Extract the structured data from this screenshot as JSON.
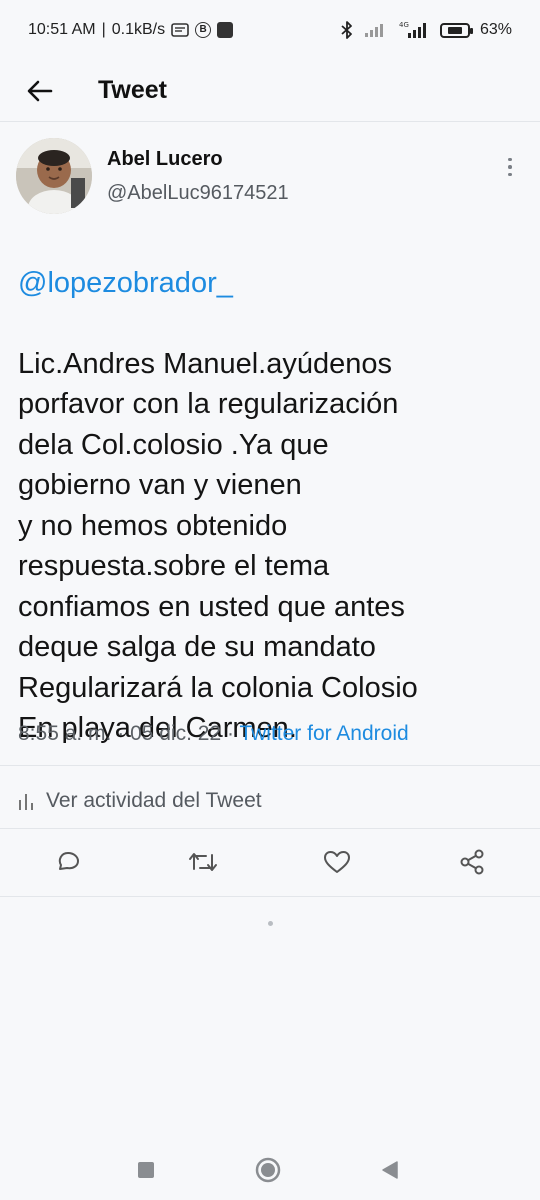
{
  "status_bar": {
    "time": "10:51 AM",
    "speed": "0.1kB/s",
    "network_label": "4G",
    "battery_text": "63%",
    "battery_level": 0.63
  },
  "header": {
    "title": "Tweet"
  },
  "tweet": {
    "author_name": "Abel Lucero",
    "author_handle": "@AbelLuc96174521",
    "mention": "@lopezobrador_",
    "text": "  Lic.Andres Manuel.ayúdenos\nporfavor  con la regularización\ndela Col.colosio .Ya que\ngobierno van y vienen\ny no hemos obtenido\nrespuesta.sobre el tema\nconfiamos en usted que antes\ndeque salga de su mandato\nRegularizará la colonia  Colosio\nEn playa del Carmen.",
    "time": "8:55 a. m.",
    "date": "05 dic. 22",
    "source": "Twitter for Android",
    "activity_label": "Ver actividad del Tweet"
  },
  "icons": {
    "back": "arrow-left-icon",
    "more": "more-vertical-icon",
    "activity": "analytics-icon",
    "reply": "reply-icon",
    "retweet": "retweet-icon",
    "like": "heart-icon",
    "share": "share-icon"
  },
  "colors": {
    "link": "#1d8be0",
    "background": "#f7f8fa",
    "divider": "#e3e6ea"
  }
}
